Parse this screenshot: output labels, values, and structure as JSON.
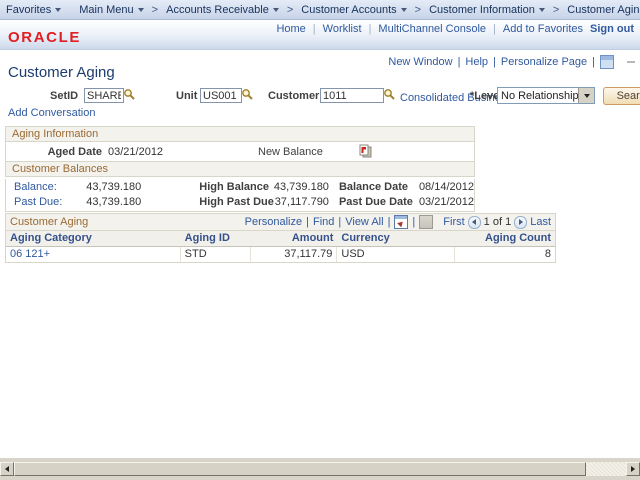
{
  "ui": {
    "pipe": "|",
    "gt": ">"
  },
  "breadcrumb": {
    "favorites": "Favorites",
    "main_menu": "Main Menu",
    "path": [
      "Accounts Receivable",
      "Customer Accounts",
      "Customer Information",
      "Customer Aging"
    ]
  },
  "header": {
    "logo": "ORACLE",
    "links": [
      "Home",
      "Worklist",
      "MultiChannel Console",
      "Add to Favorites"
    ],
    "sign_out": "Sign out"
  },
  "pagebar": {
    "new_window": "New Window",
    "help": "Help",
    "personalize_page": "Personalize Page"
  },
  "page": {
    "title": "Customer Aging",
    "add_conversation": "Add Conversation"
  },
  "filters": {
    "setid_label": "SetID",
    "setid_value": "SHARE",
    "unit_label": "Unit",
    "unit_value": "US001",
    "customer_label": "Customer",
    "customer_value": "1011",
    "consolidated_business_link": "Consolidated Business",
    "level_label": "*Level",
    "level_value": "No Relationship",
    "search_button": "Search"
  },
  "aging_information": {
    "title": "Aging Information",
    "aged_date_label": "Aged Date",
    "aged_date_value": "03/21/2012",
    "new_balance_label": "New Balance"
  },
  "customer_balances": {
    "title": "Customer Balances",
    "rows": [
      {
        "label": "Balance:",
        "value": "43,739.180",
        "high_label": "High Balance",
        "high_value": "43,739.180",
        "date_label": "Balance Date",
        "date_value": "08/14/2012"
      },
      {
        "label": "Past Due:",
        "value": "43,739.180",
        "high_label": "High Past Due",
        "high_value": "37,117.790",
        "date_label": "Past Due Date",
        "date_value": "03/21/2012"
      }
    ]
  },
  "grid": {
    "title": "Customer Aging",
    "personalize": "Personalize",
    "find": "Find",
    "view_all": "View All",
    "first": "First",
    "position": "1 of 1",
    "last": "Last",
    "columns": [
      "Aging Category",
      "Aging ID",
      "Amount",
      "Currency",
      "Aging Count"
    ],
    "rows": [
      {
        "category": "06 121+",
        "id": "STD",
        "amount": "37,117.79",
        "currency": "USD",
        "count": "8"
      }
    ]
  }
}
